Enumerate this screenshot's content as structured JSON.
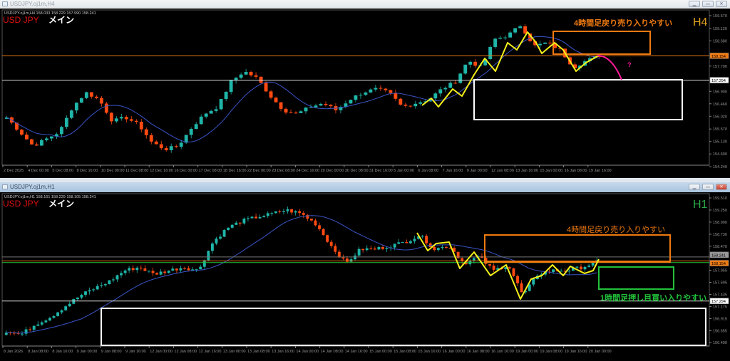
{
  "top": {
    "window_title": "USDJPY.oj1m,H4",
    "ohlc_line": "USDJPY.oj1m,H4  158.033 158.229 157.990 158.241",
    "symbol_label": "USD JPY",
    "main_label": "メイン",
    "timeframe_label": "H4",
    "annotation": "4時間足戻り売り入りやすい",
    "question_mark": "?",
    "price_ticks": [
      "159.570",
      "159.120",
      "158.680",
      "157.790",
      "156.900",
      "156.460",
      "156.020",
      "155.570",
      "155.130",
      "154.690",
      "154.240"
    ],
    "price_tick_values": [
      159.57,
      159.12,
      158.68,
      157.79,
      156.9,
      156.46,
      156.02,
      155.57,
      155.13,
      154.69,
      154.24
    ],
    "current_price": "158.154",
    "level_price": "157.294",
    "time_ticks": [
      "2 Dec 2025",
      "4 Dec 00:00",
      "5 Dec 08:00",
      "8 Dec 16:00",
      "10 Dec 00:00",
      "11 Dec 08:00",
      "12 Dec 16:00",
      "16 Dec 00:00",
      "17 Dec 08:00",
      "18 Dec 16:00",
      "22 Dec 00:00",
      "23 Dec 08:00",
      "24 Dec 16:00",
      "29 Dec 00:00",
      "30 Dec 08:00",
      "31 Dec 16:00",
      "5 Jan 00:00",
      "6 Jan 08:00",
      "7 Jan 16:00",
      "9 Jan 00:00",
      "12 Jan 08:00",
      "13 Jan 16:00",
      "15 Jan 00:00",
      "16 Jan 08:00",
      "19 Jan 16:00"
    ],
    "closes": [
      155.98,
      155.47,
      154.97,
      155.22,
      155.47,
      156.35,
      156.86,
      156.61,
      155.85,
      155.98,
      155.73,
      155.1,
      154.85,
      154.97,
      155.6,
      156.1,
      156.35,
      157.23,
      157.61,
      157.36,
      156.73,
      156.23,
      156.1,
      156.35,
      156.48,
      156.23,
      156.61,
      156.86,
      156.98,
      156.86,
      156.35,
      156.48,
      156.61,
      156.98,
      157.23,
      157.99,
      157.74,
      158.74,
      158.87,
      159.24,
      158.49,
      158.62,
      158.36,
      157.74,
      157.99,
      158.16
    ]
  },
  "bottom": {
    "window_title": "USDJPY.oj1m,H1",
    "ohlc_line": "USDJPY.oj1m,H1  158.161 158.229 158.105 158.241",
    "symbol_label": "USD JPY",
    "main_label": "メイン",
    "timeframe_label": "H1",
    "annotation_sell": "4時間足戻り売り入りやすい",
    "annotation_buy": "1時間足押し目買い入りやすい",
    "price_ticks": [
      "159.510",
      "159.250",
      "158.990",
      "158.730",
      "158.470",
      "157.955",
      "157.695",
      "157.435",
      "157.175",
      "156.915",
      "156.655",
      "156.400"
    ],
    "price_tick_values": [
      159.51,
      159.25,
      158.99,
      158.73,
      158.47,
      157.955,
      157.695,
      157.435,
      157.175,
      156.915,
      156.655,
      156.4
    ],
    "ask_price": "158.241",
    "current_price": "158.154",
    "level_price": "157.294",
    "time_ticks": [
      "8 Jan 2026",
      "8 Jan 08:00",
      "8 Jan 16:00",
      "9 Jan 00:00",
      "9 Jan 08:00",
      "9 Jan 16:00",
      "12 Jan 00:00",
      "12 Jan 08:00",
      "12 Jan 16:00",
      "13 Jan 00:00",
      "13 Jan 08:00",
      "13 Jan 16:00",
      "14 Jan 00:00",
      "14 Jan 08:00",
      "14 Jan 16:00",
      "15 Jan 00:00",
      "15 Jan 08:00",
      "15 Jan 16:00",
      "16 Jan 00:00",
      "16 Jan 08:00",
      "16 Jan 16:00",
      "19 Jan 00:00",
      "19 Jan 08:00",
      "19 Jan 16:00",
      "20 Jan 00:00"
    ],
    "closes": [
      156.65,
      156.57,
      156.8,
      156.95,
      157.18,
      157.41,
      157.57,
      157.72,
      157.95,
      158.02,
      157.87,
      157.95,
      158.02,
      157.95,
      158.56,
      158.87,
      159.02,
      159.1,
      159.17,
      159.25,
      159.17,
      158.94,
      158.48,
      158.1,
      158.41,
      158.41,
      158.48,
      158.56,
      158.71,
      158.41,
      158.48,
      158.1,
      158.25,
      157.95,
      158.07,
      157.41,
      157.87,
      157.95,
      157.95,
      158.02,
      158.13
    ]
  },
  "colors": {
    "bull": "#1fb5a8",
    "bear": "#ff4a12",
    "ma": "#3a55c8",
    "orange": "#f07a10",
    "yellow": "#f5f01a",
    "pink": "#ff1a9a",
    "green": "#22c23a",
    "symbol": "#e01010"
  }
}
